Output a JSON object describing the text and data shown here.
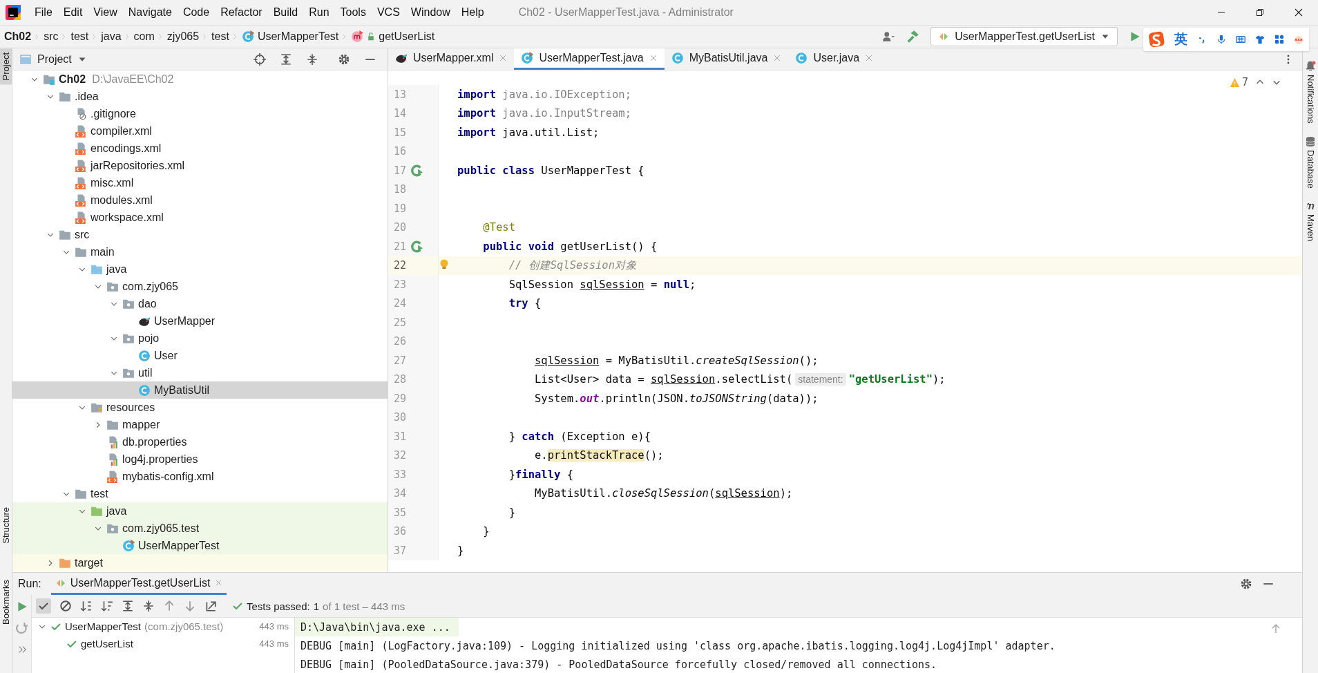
{
  "title_bar": {
    "menu": [
      "File",
      "Edit",
      "View",
      "Navigate",
      "Code",
      "Refactor",
      "Build",
      "Run",
      "Tools",
      "VCS",
      "Window",
      "Help"
    ],
    "title": "Ch02 - UserMapperTest.java - Administrator"
  },
  "navigation_bar": {
    "crumbs": [
      {
        "label": "Ch02",
        "kind": "project"
      },
      {
        "label": "src",
        "kind": "folder"
      },
      {
        "label": "test",
        "kind": "folder"
      },
      {
        "label": "java",
        "kind": "folder"
      },
      {
        "label": "com",
        "kind": "folder"
      },
      {
        "label": "zjy065",
        "kind": "folder"
      },
      {
        "label": "test",
        "kind": "folder"
      },
      {
        "label": "UserMapperTest",
        "kind": "test-class"
      },
      {
        "label": "getUserList",
        "kind": "method"
      }
    ],
    "run_config": "UserMapperTest.getUserList"
  },
  "input_method_bar": {
    "language": "英"
  },
  "left_stripe": [
    {
      "label": "Project",
      "selected": true
    },
    {
      "label": "Structure",
      "selected": false
    },
    {
      "label": "Bookmarks",
      "selected": false
    }
  ],
  "project_panel": {
    "title": "Project",
    "tree": [
      {
        "label": "Ch02",
        "path": "D:\\JavaEE\\Ch02",
        "kind": "module",
        "expanded": true,
        "selected": false,
        "children": [
          {
            "label": ".idea",
            "kind": "folder",
            "expanded": true,
            "selected": false,
            "children": [
              {
                "label": ".gitignore",
                "kind": "ignore",
                "selected": false
              },
              {
                "label": "compiler.xml",
                "kind": "xml",
                "selected": false
              },
              {
                "label": "encodings.xml",
                "kind": "xml",
                "selected": false
              },
              {
                "label": "jarRepositories.xml",
                "kind": "xml",
                "selected": false
              },
              {
                "label": "misc.xml",
                "kind": "xml",
                "selected": false
              },
              {
                "label": "modules.xml",
                "kind": "xml",
                "selected": false
              },
              {
                "label": "workspace.xml",
                "kind": "xml",
                "selected": false
              }
            ]
          },
          {
            "label": "src",
            "kind": "folder",
            "expanded": true,
            "selected": false,
            "children": [
              {
                "label": "main",
                "kind": "folder",
                "expanded": true,
                "selected": false,
                "children": [
                  {
                    "label": "java",
                    "kind": "source",
                    "expanded": true,
                    "selected": false,
                    "children": [
                      {
                        "label": "com.zjy065",
                        "kind": "package",
                        "expanded": true,
                        "selected": false,
                        "children": [
                          {
                            "label": "dao",
                            "kind": "package",
                            "expanded": true,
                            "selected": false,
                            "children": [
                              {
                                "label": "UserMapper",
                                "kind": "mapper",
                                "selected": false
                              }
                            ]
                          },
                          {
                            "label": "pojo",
                            "kind": "package",
                            "expanded": true,
                            "selected": false,
                            "children": [
                              {
                                "label": "User",
                                "kind": "class",
                                "selected": false
                              }
                            ]
                          },
                          {
                            "label": "util",
                            "kind": "package",
                            "expanded": true,
                            "selected": false,
                            "children": [
                              {
                                "label": "MyBatisUtil",
                                "kind": "class",
                                "selected": true
                              }
                            ]
                          }
                        ]
                      }
                    ]
                  },
                  {
                    "label": "resources",
                    "kind": "resources",
                    "expanded": true,
                    "selected": false,
                    "children": [
                      {
                        "label": "mapper",
                        "kind": "folder",
                        "expanded": false,
                        "selected": false
                      },
                      {
                        "label": "db.properties",
                        "kind": "properties",
                        "selected": false
                      },
                      {
                        "label": "log4j.properties",
                        "kind": "properties",
                        "selected": false
                      },
                      {
                        "label": "mybatis-config.xml",
                        "kind": "xml",
                        "selected": false
                      }
                    ]
                  }
                ]
              },
              {
                "label": "test",
                "kind": "folder",
                "expanded": true,
                "selected": false,
                "children": [
                  {
                    "label": "java",
                    "kind": "test-source",
                    "test_scope": true,
                    "expanded": true,
                    "selected": false,
                    "children": [
                      {
                        "label": "com.zjy065.test",
                        "kind": "package",
                        "test_scope": true,
                        "expanded": true,
                        "selected": false,
                        "children": [
                          {
                            "label": "UserMapperTest",
                            "kind": "test-class",
                            "test_scope": true,
                            "selected": false
                          }
                        ]
                      }
                    ]
                  }
                ]
              }
            ]
          },
          {
            "label": "target",
            "kind": "excluded",
            "expanded": false,
            "selected": false
          }
        ]
      }
    ]
  },
  "editor": {
    "tabs": [
      {
        "label": "UserMapper.xml",
        "kind": "mapper",
        "selected": false
      },
      {
        "label": "UserMapperTest.java",
        "kind": "test-class",
        "selected": true
      },
      {
        "label": "MyBatisUtil.java",
        "kind": "class",
        "selected": false
      },
      {
        "label": "User.java",
        "kind": "class",
        "selected": false
      }
    ],
    "warnings": "7",
    "lines": [
      {
        "number": "13",
        "current": false,
        "tokens": [
          {
            "text": "import",
            "kind": "keyword"
          },
          {
            "text": " java.io.IOException;",
            "kind": "unused"
          }
        ]
      },
      {
        "number": "14",
        "current": false,
        "tokens": [
          {
            "text": "import",
            "kind": "keyword"
          },
          {
            "text": " java.io.InputStream;",
            "kind": "unused"
          }
        ]
      },
      {
        "number": "15",
        "current": false,
        "tokens": [
          {
            "text": "import",
            "kind": "keyword"
          },
          {
            "text": " java.util.List;",
            "kind": "plain"
          }
        ]
      },
      {
        "number": "16",
        "current": false
      },
      {
        "number": "17",
        "current": false,
        "runnable": true,
        "tokens": [
          {
            "text": "public class",
            "kind": "keyword"
          },
          {
            "text": " UserMapperTest {",
            "kind": "plain"
          }
        ]
      },
      {
        "number": "18",
        "current": false
      },
      {
        "number": "19",
        "current": false
      },
      {
        "number": "20",
        "current": false,
        "tokens": [
          {
            "text": "    @Test",
            "kind": "annotation"
          }
        ]
      },
      {
        "number": "21",
        "current": false,
        "runnable": true,
        "tokens": [
          {
            "text": "    public void",
            "kind": "keyword"
          },
          {
            "text": " getUserList() {",
            "kind": "plain"
          }
        ]
      },
      {
        "number": "22",
        "current": true,
        "intention": true,
        "tokens": [
          {
            "text": "        // 创建SqlSession对象",
            "kind": "comment"
          }
        ]
      },
      {
        "number": "23",
        "current": false,
        "tokens": [
          {
            "text": "        SqlSession ",
            "kind": "plain"
          },
          {
            "text": "sqlSession",
            "kind": "variable"
          },
          {
            "text": " = ",
            "kind": "plain"
          },
          {
            "text": "null",
            "kind": "keyword"
          },
          {
            "text": ";",
            "kind": "plain"
          }
        ]
      },
      {
        "number": "24",
        "current": false,
        "tokens": [
          {
            "text": "        try",
            "kind": "keyword"
          },
          {
            "text": " {",
            "kind": "plain"
          }
        ]
      },
      {
        "number": "25",
        "current": false
      },
      {
        "number": "26",
        "current": false
      },
      {
        "number": "27",
        "current": false,
        "tokens": [
          {
            "text": "            sqlSession",
            "kind": "variable"
          },
          {
            "text": " = MyBatisUtil.",
            "kind": "plain"
          },
          {
            "text": "createSqlSession",
            "kind": "static"
          },
          {
            "text": "();",
            "kind": "plain"
          }
        ]
      },
      {
        "number": "28",
        "current": false,
        "tokens": [
          {
            "text": "            List<User> data = ",
            "kind": "plain"
          },
          {
            "text": "sqlSession",
            "kind": "variable"
          },
          {
            "text": ".selectList(",
            "kind": "plain"
          },
          {
            "text": "statement:",
            "kind": "hint"
          },
          {
            "text": "\"getUserList\"",
            "kind": "string"
          },
          {
            "text": ");",
            "kind": "plain"
          }
        ]
      },
      {
        "number": "29",
        "current": false,
        "tokens": [
          {
            "text": "            System.",
            "kind": "plain"
          },
          {
            "text": "out",
            "kind": "field"
          },
          {
            "text": ".println(JSON.",
            "kind": "plain"
          },
          {
            "text": "toJSONString",
            "kind": "static"
          },
          {
            "text": "(data));",
            "kind": "plain"
          }
        ]
      },
      {
        "number": "30",
        "current": false
      },
      {
        "number": "31",
        "current": false,
        "tokens": [
          {
            "text": "        } ",
            "kind": "plain"
          },
          {
            "text": "catch",
            "kind": "keyword"
          },
          {
            "text": " (Exception e){",
            "kind": "plain"
          }
        ]
      },
      {
        "number": "32",
        "current": false,
        "tokens": [
          {
            "text": "            e.",
            "kind": "plain"
          },
          {
            "text": "printStackTrace",
            "kind": "warning"
          },
          {
            "text": "();",
            "kind": "plain"
          }
        ]
      },
      {
        "number": "33",
        "current": false,
        "tokens": [
          {
            "text": "        }",
            "kind": "plain"
          },
          {
            "text": "finally",
            "kind": "keyword"
          },
          {
            "text": " {",
            "kind": "plain"
          }
        ]
      },
      {
        "number": "34",
        "current": false,
        "tokens": [
          {
            "text": "            MyBatisUtil.",
            "kind": "plain"
          },
          {
            "text": "closeSqlSession",
            "kind": "static"
          },
          {
            "text": "(",
            "kind": "plain"
          },
          {
            "text": "sqlSession",
            "kind": "variable"
          },
          {
            "text": ");",
            "kind": "plain"
          }
        ]
      },
      {
        "number": "35",
        "current": false,
        "tokens": [
          {
            "text": "        }",
            "kind": "plain"
          }
        ]
      },
      {
        "number": "36",
        "current": false,
        "tokens": [
          {
            "text": "    }",
            "kind": "plain"
          }
        ]
      },
      {
        "number": "37",
        "current": false,
        "tokens": [
          {
            "text": "}",
            "kind": "plain"
          }
        ]
      }
    ]
  },
  "right_stripe": [
    "Notifications",
    "Database",
    "Maven"
  ],
  "run_panel": {
    "label": "Run:",
    "tab": "UserMapperTest.getUserList",
    "status": {
      "label": "Tests passed:",
      "count": "1",
      "detail": "of 1 test – 443 ms"
    },
    "tests": [
      {
        "name": "UserMapperTest",
        "package": "(com.zjy065.test)",
        "time": "443 ms",
        "passed": true,
        "expanded": true,
        "selected": false,
        "children": [
          {
            "name": "getUserList",
            "time": "443 ms",
            "passed": true,
            "selected": false
          }
        ]
      }
    ],
    "console": [
      {
        "text": "D:\\Java\\bin\\java.exe ...",
        "kind": "command"
      },
      {
        "text": "DEBUG [main] (LogFactory.java:109) - Logging initialized using 'class org.apache.ibatis.logging.log4j.Log4jImpl' adapter.",
        "kind": "log"
      },
      {
        "text": "DEBUG [main] (PooledDataSource.java:379) - PooledDataSource forcefully closed/removed all connections.",
        "kind": "log"
      }
    ]
  }
}
